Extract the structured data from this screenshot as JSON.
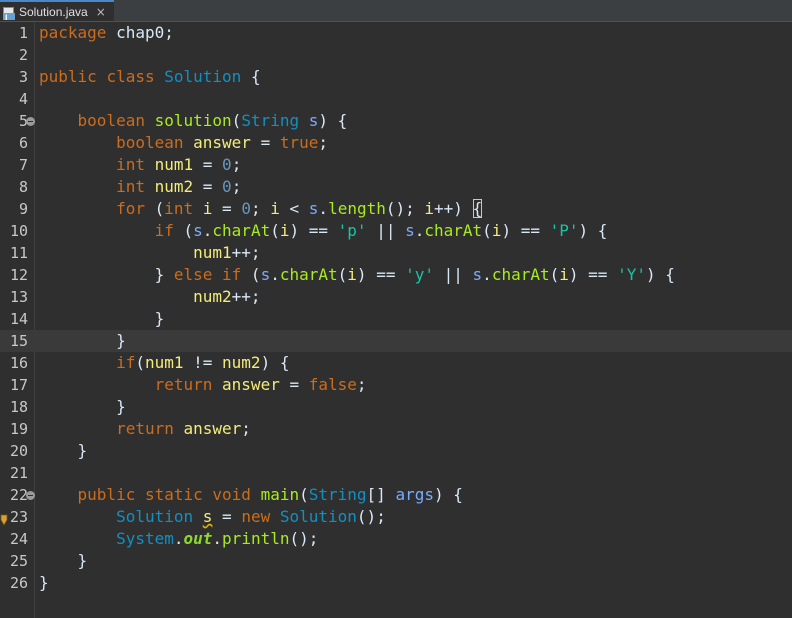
{
  "tab": {
    "title": "Solution.java",
    "close": "×",
    "icon": "java-file-icon"
  },
  "colors": {
    "keyword": "#cc6c1d",
    "type": "#1290c3",
    "method": "#a7ec21",
    "param": "#79abff",
    "local": "#f3ec79",
    "field": "#66e1f8",
    "string": "#17c6a3",
    "background": "#2f2f2f"
  },
  "current_line": 15,
  "lines": [
    {
      "n": "1",
      "tokens": [
        {
          "t": "package",
          "c": "kw"
        },
        {
          "t": " chap0;",
          "c": "df"
        }
      ]
    },
    {
      "n": "2",
      "tokens": []
    },
    {
      "n": "3",
      "tokens": [
        {
          "t": "public",
          "c": "kw"
        },
        {
          "t": " ",
          "c": "df"
        },
        {
          "t": "class",
          "c": "kw"
        },
        {
          "t": " ",
          "c": "df"
        },
        {
          "t": "Solution",
          "c": "ty"
        },
        {
          "t": " {",
          "c": "df"
        }
      ]
    },
    {
      "n": "4",
      "tokens": []
    },
    {
      "n": "5",
      "fold": true,
      "tokens": [
        {
          "t": "    ",
          "c": "df"
        },
        {
          "t": "boolean",
          "c": "kw"
        },
        {
          "t": " ",
          "c": "df"
        },
        {
          "t": "solution",
          "c": "fn"
        },
        {
          "t": "(",
          "c": "df"
        },
        {
          "t": "String",
          "c": "ty"
        },
        {
          "t": " ",
          "c": "df"
        },
        {
          "t": "s",
          "c": "pm"
        },
        {
          "t": ") {",
          "c": "df"
        }
      ]
    },
    {
      "n": "6",
      "tokens": [
        {
          "t": "        ",
          "c": "df"
        },
        {
          "t": "boolean",
          "c": "kw"
        },
        {
          "t": " ",
          "c": "df"
        },
        {
          "t": "answer",
          "c": "id"
        },
        {
          "t": " = ",
          "c": "df"
        },
        {
          "t": "true",
          "c": "kw"
        },
        {
          "t": ";",
          "c": "df"
        }
      ]
    },
    {
      "n": "7",
      "tokens": [
        {
          "t": "        ",
          "c": "df"
        },
        {
          "t": "int",
          "c": "kw"
        },
        {
          "t": " ",
          "c": "df"
        },
        {
          "t": "num1",
          "c": "id"
        },
        {
          "t": " = ",
          "c": "df"
        },
        {
          "t": "0",
          "c": "nu"
        },
        {
          "t": ";",
          "c": "df"
        }
      ]
    },
    {
      "n": "8",
      "tokens": [
        {
          "t": "        ",
          "c": "df"
        },
        {
          "t": "int",
          "c": "kw"
        },
        {
          "t": " ",
          "c": "df"
        },
        {
          "t": "num2",
          "c": "id"
        },
        {
          "t": " = ",
          "c": "df"
        },
        {
          "t": "0",
          "c": "nu"
        },
        {
          "t": ";",
          "c": "df"
        }
      ]
    },
    {
      "n": "9",
      "tokens": [
        {
          "t": "        ",
          "c": "df"
        },
        {
          "t": "for",
          "c": "kw"
        },
        {
          "t": " (",
          "c": "df"
        },
        {
          "t": "int",
          "c": "kw"
        },
        {
          "t": " ",
          "c": "df"
        },
        {
          "t": "i",
          "c": "id"
        },
        {
          "t": " = ",
          "c": "df"
        },
        {
          "t": "0",
          "c": "nu"
        },
        {
          "t": "; ",
          "c": "df"
        },
        {
          "t": "i",
          "c": "id"
        },
        {
          "t": " < ",
          "c": "df"
        },
        {
          "t": "s",
          "c": "pm"
        },
        {
          "t": ".",
          "c": "df"
        },
        {
          "t": "length",
          "c": "fn"
        },
        {
          "t": "(); ",
          "c": "df"
        },
        {
          "t": "i",
          "c": "id"
        },
        {
          "t": "++) ",
          "c": "df"
        },
        {
          "t": "{",
          "c": "df",
          "box": true
        }
      ]
    },
    {
      "n": "10",
      "tokens": [
        {
          "t": "            ",
          "c": "df"
        },
        {
          "t": "if",
          "c": "kw"
        },
        {
          "t": " (",
          "c": "df"
        },
        {
          "t": "s",
          "c": "pm"
        },
        {
          "t": ".",
          "c": "df"
        },
        {
          "t": "charAt",
          "c": "fn"
        },
        {
          "t": "(",
          "c": "df"
        },
        {
          "t": "i",
          "c": "id"
        },
        {
          "t": ") == ",
          "c": "df"
        },
        {
          "t": "'p'",
          "c": "st"
        },
        {
          "t": " || ",
          "c": "df"
        },
        {
          "t": "s",
          "c": "pm"
        },
        {
          "t": ".",
          "c": "df"
        },
        {
          "t": "charAt",
          "c": "fn"
        },
        {
          "t": "(",
          "c": "df"
        },
        {
          "t": "i",
          "c": "id"
        },
        {
          "t": ") == ",
          "c": "df"
        },
        {
          "t": "'P'",
          "c": "st"
        },
        {
          "t": ") {",
          "c": "df"
        }
      ]
    },
    {
      "n": "11",
      "tokens": [
        {
          "t": "                ",
          "c": "df"
        },
        {
          "t": "num1",
          "c": "id"
        },
        {
          "t": "++;",
          "c": "df"
        }
      ]
    },
    {
      "n": "12",
      "tokens": [
        {
          "t": "            ",
          "c": "df"
        },
        {
          "t": "} ",
          "c": "df"
        },
        {
          "t": "else",
          "c": "kw"
        },
        {
          "t": " ",
          "c": "df"
        },
        {
          "t": "if",
          "c": "kw"
        },
        {
          "t": " (",
          "c": "df"
        },
        {
          "t": "s",
          "c": "pm"
        },
        {
          "t": ".",
          "c": "df"
        },
        {
          "t": "charAt",
          "c": "fn"
        },
        {
          "t": "(",
          "c": "df"
        },
        {
          "t": "i",
          "c": "id"
        },
        {
          "t": ") == ",
          "c": "df"
        },
        {
          "t": "'y'",
          "c": "st"
        },
        {
          "t": " || ",
          "c": "df"
        },
        {
          "t": "s",
          "c": "pm"
        },
        {
          "t": ".",
          "c": "df"
        },
        {
          "t": "charAt",
          "c": "fn"
        },
        {
          "t": "(",
          "c": "df"
        },
        {
          "t": "i",
          "c": "id"
        },
        {
          "t": ") == ",
          "c": "df"
        },
        {
          "t": "'Y'",
          "c": "st"
        },
        {
          "t": ") {",
          "c": "df"
        }
      ]
    },
    {
      "n": "13",
      "tokens": [
        {
          "t": "                ",
          "c": "df"
        },
        {
          "t": "num2",
          "c": "id"
        },
        {
          "t": "++;",
          "c": "df"
        }
      ]
    },
    {
      "n": "14",
      "tokens": [
        {
          "t": "            ",
          "c": "df"
        },
        {
          "t": "}",
          "c": "df"
        }
      ]
    },
    {
      "n": "15",
      "tokens": [
        {
          "t": "        ",
          "c": "df"
        },
        {
          "t": "}",
          "c": "df"
        }
      ]
    },
    {
      "n": "16",
      "tokens": [
        {
          "t": "        ",
          "c": "df"
        },
        {
          "t": "if",
          "c": "kw"
        },
        {
          "t": "(",
          "c": "df"
        },
        {
          "t": "num1",
          "c": "id"
        },
        {
          "t": " != ",
          "c": "df"
        },
        {
          "t": "num2",
          "c": "id"
        },
        {
          "t": ") {",
          "c": "df"
        }
      ]
    },
    {
      "n": "17",
      "tokens": [
        {
          "t": "            ",
          "c": "df"
        },
        {
          "t": "return",
          "c": "kw"
        },
        {
          "t": " ",
          "c": "df"
        },
        {
          "t": "answer",
          "c": "id"
        },
        {
          "t": " = ",
          "c": "df"
        },
        {
          "t": "false",
          "c": "kw"
        },
        {
          "t": ";",
          "c": "df"
        }
      ]
    },
    {
      "n": "18",
      "tokens": [
        {
          "t": "        ",
          "c": "df"
        },
        {
          "t": "}",
          "c": "df"
        }
      ]
    },
    {
      "n": "19",
      "tokens": [
        {
          "t": "        ",
          "c": "df"
        },
        {
          "t": "return",
          "c": "kw"
        },
        {
          "t": " ",
          "c": "df"
        },
        {
          "t": "answer",
          "c": "id"
        },
        {
          "t": ";",
          "c": "df"
        }
      ]
    },
    {
      "n": "20",
      "tokens": [
        {
          "t": "    ",
          "c": "df"
        },
        {
          "t": "}",
          "c": "df"
        }
      ]
    },
    {
      "n": "21",
      "tokens": []
    },
    {
      "n": "22",
      "fold": true,
      "tokens": [
        {
          "t": "    ",
          "c": "df"
        },
        {
          "t": "public",
          "c": "kw"
        },
        {
          "t": " ",
          "c": "df"
        },
        {
          "t": "static",
          "c": "kw"
        },
        {
          "t": " ",
          "c": "df"
        },
        {
          "t": "void",
          "c": "kw"
        },
        {
          "t": " ",
          "c": "df"
        },
        {
          "t": "main",
          "c": "fn"
        },
        {
          "t": "(",
          "c": "df"
        },
        {
          "t": "String",
          "c": "ty"
        },
        {
          "t": "[] ",
          "c": "df"
        },
        {
          "t": "args",
          "c": "pm"
        },
        {
          "t": ") {",
          "c": "df"
        }
      ]
    },
    {
      "n": "23",
      "warn": true,
      "tokens": [
        {
          "t": "        ",
          "c": "df"
        },
        {
          "t": "Solution",
          "c": "ty"
        },
        {
          "t": " ",
          "c": "df"
        },
        {
          "t": "s",
          "c": "id",
          "squig": true
        },
        {
          "t": " = ",
          "c": "df"
        },
        {
          "t": "new",
          "c": "kw"
        },
        {
          "t": " ",
          "c": "df"
        },
        {
          "t": "Solution",
          "c": "ty"
        },
        {
          "t": "();",
          "c": "df"
        }
      ]
    },
    {
      "n": "24",
      "tokens": [
        {
          "t": "        ",
          "c": "df"
        },
        {
          "t": "System",
          "c": "ty"
        },
        {
          "t": ".",
          "c": "df"
        },
        {
          "t": "out",
          "c": "so"
        },
        {
          "t": ".",
          "c": "df"
        },
        {
          "t": "println",
          "c": "fn"
        },
        {
          "t": "();",
          "c": "df"
        }
      ]
    },
    {
      "n": "25",
      "tokens": [
        {
          "t": "    ",
          "c": "df"
        },
        {
          "t": "}",
          "c": "df"
        }
      ]
    },
    {
      "n": "26",
      "tokens": [
        {
          "t": "}",
          "c": "df"
        }
      ]
    }
  ]
}
